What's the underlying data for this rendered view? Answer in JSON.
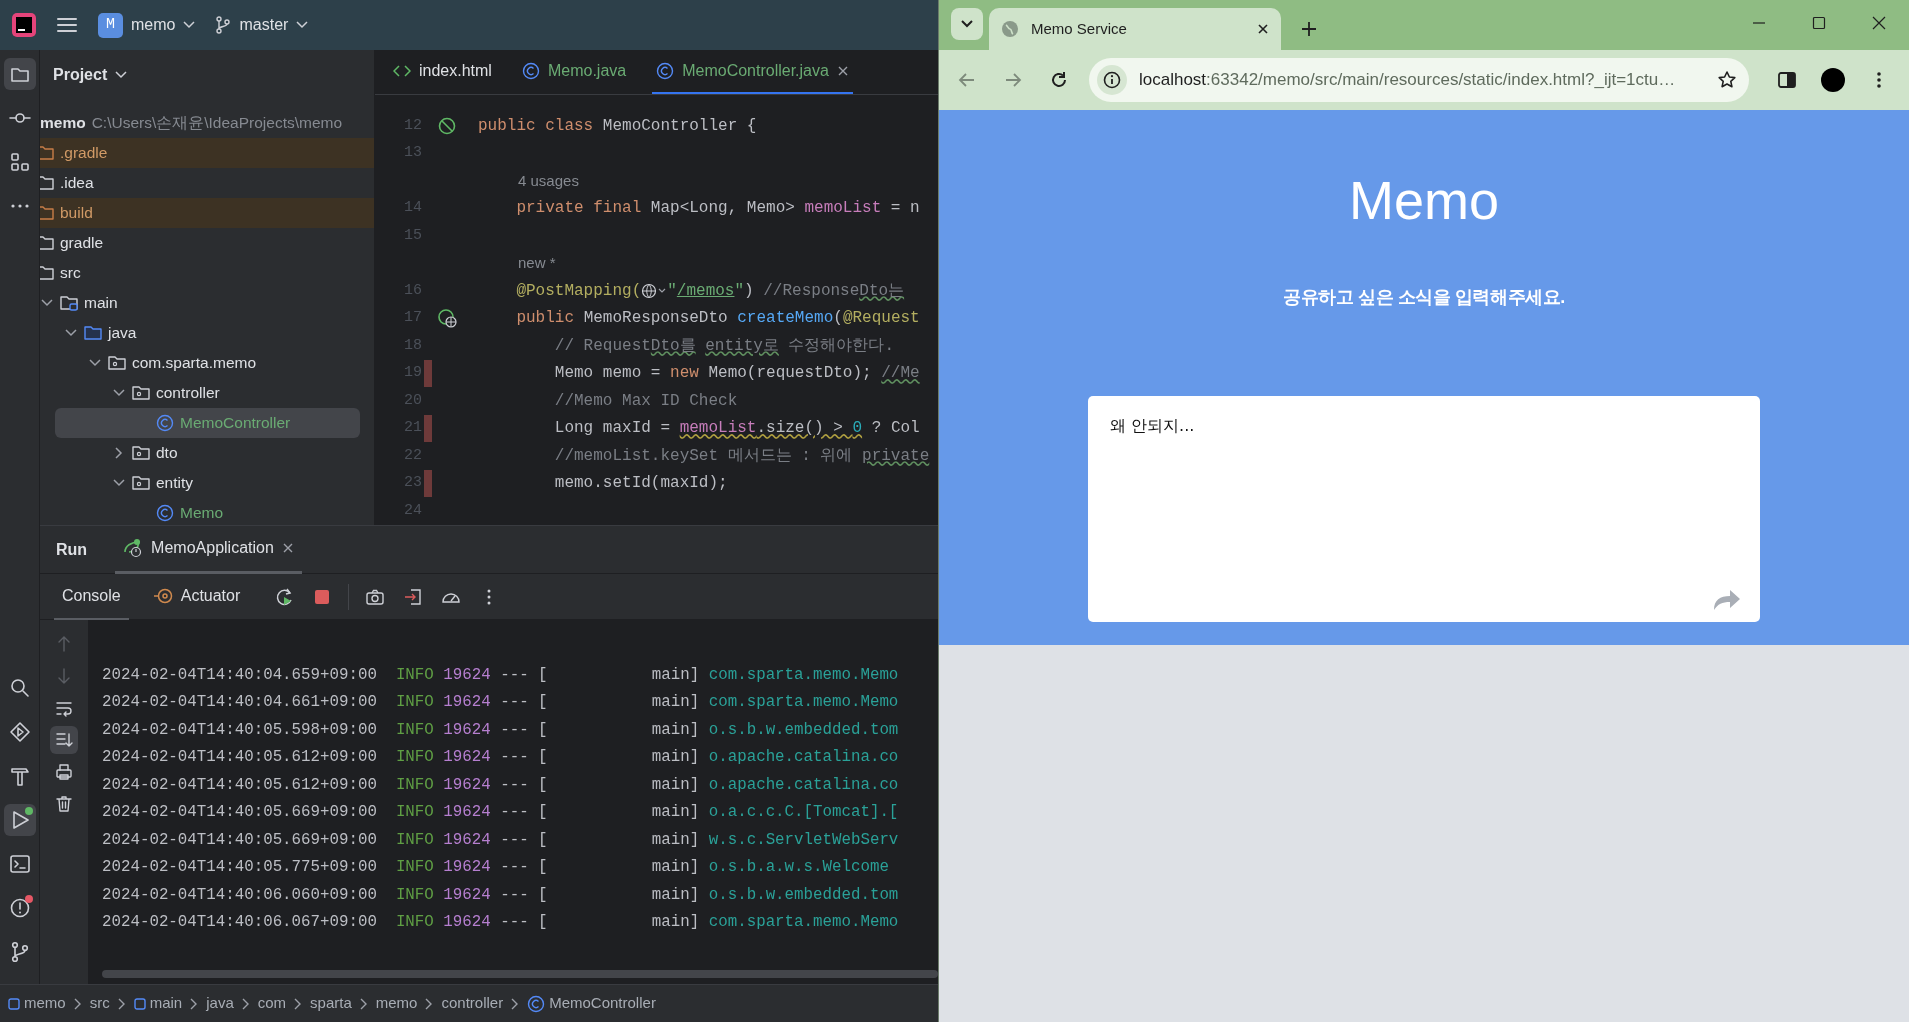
{
  "ide": {
    "toolbar": {
      "project_initial": "M",
      "project": "memo",
      "branch": "master"
    },
    "tool_stripe_top": [
      {
        "kind": "project",
        "selected": true
      },
      {
        "kind": "commit",
        "selected": false
      },
      {
        "kind": "structure",
        "selected": false
      },
      {
        "kind": "more",
        "selected": false
      }
    ],
    "tool_stripe_bottom": [
      {
        "kind": "search",
        "selected": false
      },
      {
        "kind": "services",
        "selected": false
      },
      {
        "kind": "build",
        "selected": false
      },
      {
        "kind": "run",
        "selected": true,
        "color": "#5fb865"
      },
      {
        "kind": "terminal",
        "selected": false
      },
      {
        "kind": "problems",
        "selected": false,
        "color": "#e55765"
      },
      {
        "kind": "git",
        "selected": false
      }
    ],
    "project_panel": {
      "title": "Project",
      "tree": [
        {
          "label": "memo",
          "path": "C:\\Users\\손재윤\\IdeaProjects\\memo",
          "selected": false,
          "children": [
            {
              "label": ".gradle",
              "kind": "excluded",
              "selected": false
            },
            {
              "label": ".idea",
              "kind": "folder",
              "selected": false
            },
            {
              "label": "build",
              "kind": "excluded",
              "selected": false
            },
            {
              "label": "gradle",
              "kind": "folder",
              "selected": false
            },
            {
              "label": "src",
              "kind": "folder",
              "selected": false,
              "children": [
                {
                  "label": "main",
                  "kind": "source",
                  "selected": false,
                  "expanded": true,
                  "children": [
                    {
                      "label": "java",
                      "kind": "java-root",
                      "selected": false,
                      "expanded": true,
                      "children": [
                        {
                          "label": "com.sparta.memo",
                          "kind": "package",
                          "selected": false,
                          "expanded": true,
                          "children": [
                            {
                              "label": "controller",
                              "kind": "package",
                              "selected": false,
                              "expanded": true,
                              "children": [
                                {
                                  "label": "MemoController",
                                  "kind": "class",
                                  "selected": true,
                                  "color": "#6aab73"
                                }
                              ]
                            },
                            {
                              "label": "dto",
                              "kind": "package",
                              "selected": false,
                              "expanded": false
                            },
                            {
                              "label": "entity",
                              "kind": "package",
                              "selected": false,
                              "expanded": true,
                              "children": [
                                {
                                  "label": "Memo",
                                  "kind": "class",
                                  "selected": false,
                                  "color": "#6aab73"
                                }
                              ]
                            }
                          ]
                        }
                      ]
                    }
                  ]
                }
              ]
            }
          ]
        }
      ]
    },
    "editor": {
      "tabs": [
        {
          "label": "index.html",
          "kind": "html",
          "selected": false,
          "color": "#dfe1e5"
        },
        {
          "label": "Memo.java",
          "kind": "class",
          "selected": false,
          "color": "#6aab73"
        },
        {
          "label": "MemoController.java",
          "kind": "class",
          "selected": true,
          "color": "#6aab73"
        }
      ],
      "lines": [
        {
          "kind": "code",
          "number": "12",
          "gutter": {
            "kind": "bean"
          },
          "changed": false,
          "tokens": [
            {
              "kind": "keyword",
              "text": "public class "
            },
            {
              "kind": "plain",
              "text": "MemoController {"
            }
          ]
        },
        {
          "kind": "code",
          "number": "13",
          "changed": false
        },
        {
          "kind": "hint",
          "text": "4 usages"
        },
        {
          "kind": "code",
          "number": "14",
          "changed": false,
          "tokens": [
            {
              "kind": "keyword",
              "text": "    private final "
            },
            {
              "kind": "plain",
              "text": "Map<Long, Memo> "
            },
            {
              "kind": "field",
              "text": "memoList"
            },
            {
              "kind": "plain",
              "text": " = n"
            }
          ]
        },
        {
          "kind": "code",
          "number": "15",
          "changed": false
        },
        {
          "kind": "hint",
          "text": "new *"
        },
        {
          "kind": "code",
          "number": "16",
          "changed": false,
          "tokens": [
            {
              "kind": "annotation",
              "text": "    @PostMapping("
            },
            {
              "kind": "globe"
            },
            {
              "kind": "string",
              "text": "\""
            },
            {
              "kind": "link",
              "text": "/memos"
            },
            {
              "kind": "string",
              "text": "\""
            },
            {
              "kind": "plain",
              "text": ") "
            },
            {
              "kind": "comment",
              "text": "//Response"
            },
            {
              "kind": "comment-squiggle",
              "text": "Dto는"
            }
          ]
        },
        {
          "kind": "code",
          "number": "17",
          "gutter": {
            "kind": "endpoint"
          },
          "changed": false,
          "tokens": [
            {
              "kind": "keyword",
              "text": "    public "
            },
            {
              "kind": "plain",
              "text": "MemoResponseDto "
            },
            {
              "kind": "method",
              "text": "createMemo"
            },
            {
              "kind": "plain",
              "text": "("
            },
            {
              "kind": "annotation",
              "text": "@Request"
            }
          ]
        },
        {
          "kind": "code",
          "number": "18",
          "changed": false,
          "tokens": [
            {
              "kind": "comment",
              "text": "        // Request"
            },
            {
              "kind": "comment-squiggle",
              "text": "Dto를"
            },
            {
              "kind": "comment-squiggle-spaced",
              "text": "entity로"
            },
            {
              "kind": "comment",
              "text": " 수정해야한다."
            }
          ]
        },
        {
          "kind": "code",
          "number": "19",
          "changed": true,
          "tokens": [
            {
              "kind": "plain",
              "text": "        Memo memo = "
            },
            {
              "kind": "keyword",
              "text": "new "
            },
            {
              "kind": "plain",
              "text": "Memo(requestDto); "
            },
            {
              "kind": "comment-squiggle",
              "text": "//Me"
            }
          ]
        },
        {
          "kind": "code",
          "number": "20",
          "changed": false,
          "tokens": [
            {
              "kind": "comment",
              "text": "        //Memo Max ID Check"
            }
          ]
        },
        {
          "kind": "code",
          "number": "21",
          "changed": true,
          "tokens": [
            {
              "kind": "plain",
              "text": "        Long maxId = "
            },
            {
              "kind": "field-squiggle",
              "text": "memoList"
            },
            {
              "kind": "plain-squiggle",
              "text": ".size() > "
            },
            {
              "kind": "number-squiggle",
              "text": "0"
            },
            {
              "kind": "plain",
              "text": " ? Col"
            }
          ]
        },
        {
          "kind": "code",
          "number": "22",
          "changed": false,
          "tokens": [
            {
              "kind": "comment",
              "text": "        //memoList.keySet 메서드는 : 위에 "
            },
            {
              "kind": "comment-squiggle",
              "text": "private"
            }
          ]
        },
        {
          "kind": "code",
          "number": "23",
          "changed": true,
          "tokens": [
            {
              "kind": "plain",
              "text": "        memo.setId(maxId);"
            }
          ]
        },
        {
          "kind": "code",
          "number": "24",
          "changed": false
        }
      ]
    },
    "run_panel": {
      "title": "Run",
      "tab": {
        "label": "MemoApplication"
      },
      "subtabs": [
        {
          "label": "Console",
          "kind": "console",
          "selected": true
        },
        {
          "label": "Actuator",
          "kind": "actuator",
          "selected": false
        }
      ],
      "actions": [
        {
          "kind": "rerun"
        },
        {
          "kind": "stop"
        },
        {
          "kind": "screenshot"
        },
        {
          "kind": "exit"
        },
        {
          "kind": "dashboard"
        },
        {
          "kind": "more"
        }
      ],
      "side_tools": [
        {
          "kind": "up",
          "disabled": true,
          "selected": false
        },
        {
          "kind": "down",
          "disabled": true,
          "selected": false
        },
        {
          "kind": "wrap",
          "disabled": false,
          "selected": false
        },
        {
          "kind": "scroll-end",
          "disabled": false,
          "selected": true
        },
        {
          "kind": "print",
          "disabled": false,
          "selected": false
        },
        {
          "kind": "clear",
          "disabled": false,
          "selected": false
        }
      ],
      "log": [
        {
          "time": "2024-02-04T14:40:04.659+09:00",
          "level": "INFO",
          "pid": "19624",
          "separator": "--- [",
          "thread": "main]",
          "logger": "com.sparta.memo.Memo"
        },
        {
          "time": "2024-02-04T14:40:04.661+09:00",
          "level": "INFO",
          "pid": "19624",
          "separator": "--- [",
          "thread": "main]",
          "logger": "com.sparta.memo.Memo"
        },
        {
          "time": "2024-02-04T14:40:05.598+09:00",
          "level": "INFO",
          "pid": "19624",
          "separator": "--- [",
          "thread": "main]",
          "logger": "o.s.b.w.embedded.tom"
        },
        {
          "time": "2024-02-04T14:40:05.612+09:00",
          "level": "INFO",
          "pid": "19624",
          "separator": "--- [",
          "thread": "main]",
          "logger": "o.apache.catalina.co"
        },
        {
          "time": "2024-02-04T14:40:05.612+09:00",
          "level": "INFO",
          "pid": "19624",
          "separator": "--- [",
          "thread": "main]",
          "logger": "o.apache.catalina.co"
        },
        {
          "time": "2024-02-04T14:40:05.669+09:00",
          "level": "INFO",
          "pid": "19624",
          "separator": "--- [",
          "thread": "main]",
          "logger": "o.a.c.c.C.[Tomcat].["
        },
        {
          "time": "2024-02-04T14:40:05.669+09:00",
          "level": "INFO",
          "pid": "19624",
          "separator": "--- [",
          "thread": "main]",
          "logger": "w.s.c.ServletWebServ"
        },
        {
          "time": "2024-02-04T14:40:05.775+09:00",
          "level": "INFO",
          "pid": "19624",
          "separator": "--- [",
          "thread": "main]",
          "logger": "o.s.b.a.w.s.Welcome"
        },
        {
          "time": "2024-02-04T14:40:06.060+09:00",
          "level": "INFO",
          "pid": "19624",
          "separator": "--- [",
          "thread": "main]",
          "logger": "o.s.b.w.embedded.tom"
        },
        {
          "time": "2024-02-04T14:40:06.067+09:00",
          "level": "INFO",
          "pid": "19624",
          "separator": "--- [",
          "thread": "main]",
          "logger": "com.sparta.memo.Memo"
        }
      ]
    },
    "breadcrumbs": [
      {
        "label": "memo",
        "kind": "module"
      },
      {
        "label": "src",
        "kind": "folder"
      },
      {
        "label": "main",
        "kind": "module"
      },
      {
        "label": "java",
        "kind": "folder"
      },
      {
        "label": "com",
        "kind": "folder"
      },
      {
        "label": "sparta",
        "kind": "folder"
      },
      {
        "label": "memo",
        "kind": "folder"
      },
      {
        "label": "controller",
        "kind": "folder"
      },
      {
        "label": "MemoController",
        "kind": "class"
      }
    ]
  },
  "browser": {
    "tab": {
      "title": "Memo Service"
    },
    "address": {
      "host": "localhost",
      "rest": ":63342/memo/src/main/resources/static/index.html?_ijt=1ctu…"
    },
    "page": {
      "title": "Memo",
      "subtitle": "공유하고 싶은 소식을 입력해주세요.",
      "memo": {
        "value": "왜 안되지..."
      }
    }
  }
}
